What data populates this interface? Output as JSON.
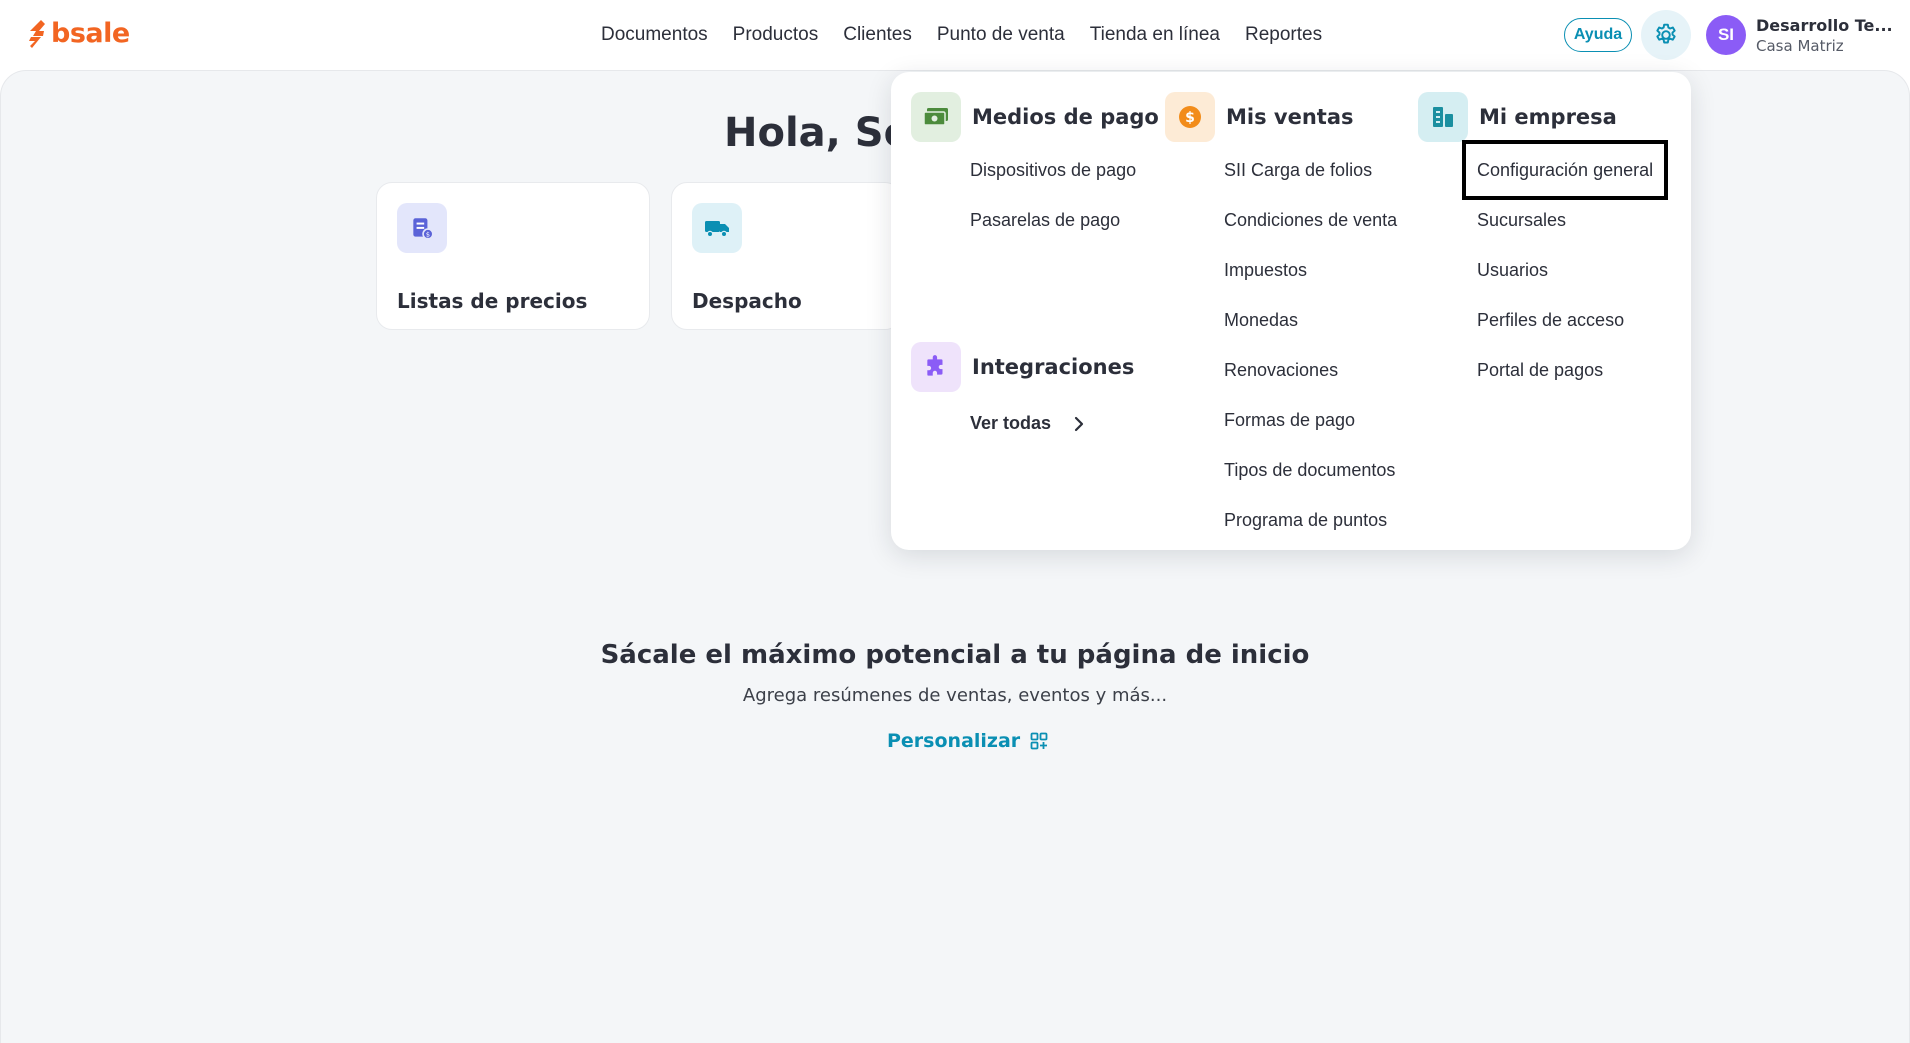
{
  "brand": {
    "name": "bsale",
    "color": "#f26522"
  },
  "nav": {
    "items": [
      "Documentos",
      "Productos",
      "Clientes",
      "Punto de venta",
      "Tienda en línea",
      "Reportes"
    ]
  },
  "header": {
    "help_label": "Ayuda",
    "settings_icon": "gear-icon",
    "avatar_initials": "SI",
    "user_name": "Desarrollo Te...",
    "branch": "Casa Matriz"
  },
  "main": {
    "greeting": "Hola, Sop",
    "cards": [
      {
        "title": "Listas de precios",
        "icon": "price-list-icon"
      },
      {
        "title": "Despacho",
        "icon": "truck-icon"
      }
    ],
    "promo_title": "Sácale el máximo potencial a tu página de inicio",
    "promo_subtitle": "Agrega resúmenes de ventas, eventos y más...",
    "personalize_label": "Personalizar"
  },
  "settings_menu": {
    "payment": {
      "title": "Medios de pago",
      "icon": "money-icon",
      "items": [
        "Dispositivos de pago",
        "Pasarelas de pago"
      ]
    },
    "integrations": {
      "title": "Integraciones",
      "icon": "puzzle-icon",
      "see_all": "Ver todas"
    },
    "sales": {
      "title": "Mis ventas",
      "icon": "dollar-coin-icon",
      "items": [
        "SII Carga de folios",
        "Condiciones de venta",
        "Impuestos",
        "Monedas",
        "Renovaciones",
        "Formas de pago",
        "Tipos de documentos",
        "Programa de puntos"
      ]
    },
    "company": {
      "title": "Mi empresa",
      "icon": "building-icon",
      "items": [
        "Configuración general",
        "Sucursales",
        "Usuarios",
        "Perfiles de acceso",
        "Portal de pagos"
      ],
      "highlighted_item": "Configuración general"
    }
  },
  "colors": {
    "accent": "#0a8fb3",
    "avatar": "#8b5cf6",
    "background": "#f4f6f8"
  }
}
